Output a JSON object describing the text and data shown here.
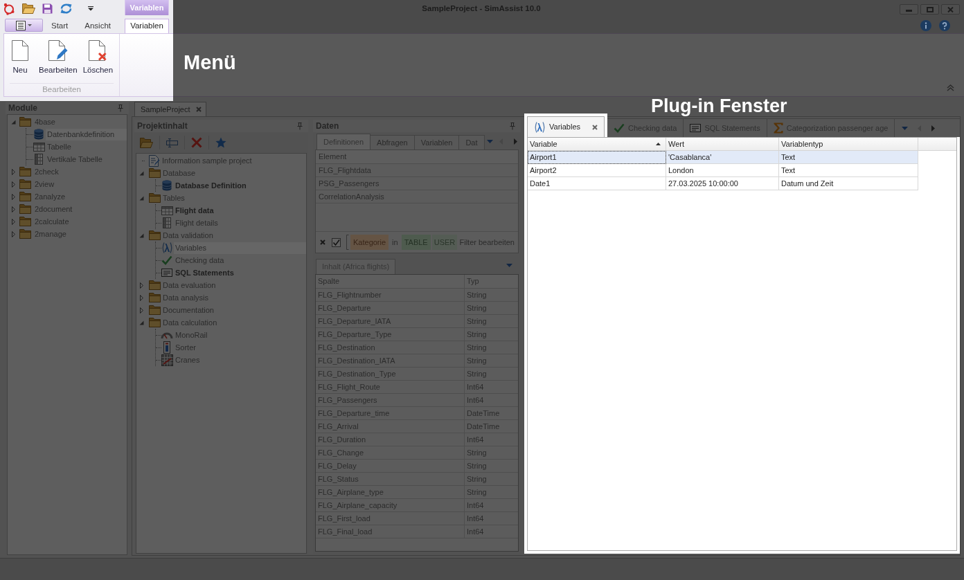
{
  "window": {
    "title": "SampleProject - SimAssist 10.0"
  },
  "ribbon": {
    "highlighted": true,
    "annotation": "Menü",
    "contextual_header": "Variablen",
    "tabs": [
      {
        "label": "Start",
        "selected": false,
        "contextual": false
      },
      {
        "label": "Ansicht",
        "selected": false,
        "contextual": false
      },
      {
        "label": "Variablen",
        "selected": true,
        "contextual": true
      }
    ],
    "groups": [
      {
        "label": "Bearbeiten",
        "buttons": [
          {
            "label": "Neu",
            "kind": "new"
          },
          {
            "label": "Bearbeiten",
            "kind": "edit"
          },
          {
            "label": "Löschen",
            "kind": "delete"
          }
        ]
      }
    ]
  },
  "module_panel": {
    "title": "Module",
    "highlighted": false,
    "tree": [
      {
        "label": "4base",
        "kind": "folder",
        "expanded": true,
        "selected": false,
        "children": [
          {
            "label": "Datenbankdefinition",
            "kind": "database",
            "selected": true
          },
          {
            "label": "Tabelle",
            "kind": "table",
            "selected": false
          },
          {
            "label": "Vertikale Tabelle",
            "kind": "vertical_table",
            "selected": false
          }
        ]
      },
      {
        "label": "2check",
        "kind": "folder",
        "expanded": false,
        "selected": false
      },
      {
        "label": "2view",
        "kind": "folder",
        "expanded": false,
        "selected": false
      },
      {
        "label": "2analyze",
        "kind": "folder",
        "expanded": false,
        "selected": false
      },
      {
        "label": "2document",
        "kind": "folder",
        "expanded": false,
        "selected": false
      },
      {
        "label": "2calculate",
        "kind": "folder",
        "expanded": false,
        "selected": false
      },
      {
        "label": "2manage",
        "kind": "folder",
        "expanded": false,
        "selected": false
      }
    ]
  },
  "document_tabs": [
    {
      "label": "SampleProject",
      "selected": true
    }
  ],
  "project_panel": {
    "title": "Projektinhalt",
    "highlighted": false,
    "tree": [
      {
        "label": "Information sample project",
        "kind": "document",
        "selected": false,
        "bold": false
      },
      {
        "label": "Database",
        "kind": "folder",
        "expanded": true,
        "selected": false,
        "bold": false,
        "children": [
          {
            "label": "Database Definition",
            "kind": "database",
            "selected": false,
            "bold": true
          }
        ]
      },
      {
        "label": "Tables",
        "kind": "folder",
        "expanded": true,
        "selected": false,
        "bold": false,
        "children": [
          {
            "label": "Flight data",
            "kind": "table",
            "selected": false,
            "bold": true
          },
          {
            "label": "Flight details",
            "kind": "vertical_table",
            "selected": false,
            "bold": false
          }
        ]
      },
      {
        "label": "Data validation",
        "kind": "folder",
        "expanded": true,
        "selected": false,
        "bold": false,
        "children": [
          {
            "label": "Variables",
            "kind": "lambda",
            "selected": true,
            "bold": false
          },
          {
            "label": "Checking data",
            "kind": "check",
            "selected": false,
            "bold": false
          },
          {
            "label": "SQL Statements",
            "kind": "sql",
            "selected": false,
            "bold": true
          }
        ]
      },
      {
        "label": "Data evaluation",
        "kind": "folder",
        "expanded": false,
        "selected": false,
        "bold": false
      },
      {
        "label": "Data analysis",
        "kind": "folder",
        "expanded": false,
        "selected": false,
        "bold": false
      },
      {
        "label": "Documentation",
        "kind": "folder",
        "expanded": false,
        "selected": false,
        "bold": false
      },
      {
        "label": "Data calculation",
        "kind": "folder",
        "expanded": true,
        "selected": false,
        "bold": false,
        "children": [
          {
            "label": "MonoRail",
            "kind": "gauge",
            "selected": false,
            "bold": false
          },
          {
            "label": "Sorter",
            "kind": "sorter",
            "selected": false,
            "bold": false
          },
          {
            "label": "Cranes",
            "kind": "crane",
            "selected": false,
            "bold": false
          }
        ]
      }
    ]
  },
  "data_panel": {
    "title": "Daten",
    "highlighted": false,
    "tabs": [
      {
        "label": "Definitionen",
        "selected": true
      },
      {
        "label": "Abfragen",
        "selected": false
      },
      {
        "label": "Variablen",
        "selected": false
      },
      {
        "label": "Dat",
        "selected": false
      }
    ],
    "definitions": {
      "columns": [
        "Element"
      ],
      "rows": [
        "FLG_Flightdata",
        "PSG_Passengers",
        "CorrelationAnalysis"
      ]
    },
    "filter": {
      "enabled": true,
      "tokens": [
        {
          "text": "Kategorie",
          "kind": "field"
        },
        {
          "text": "in",
          "kind": "operator"
        },
        {
          "text": "TABLE",
          "kind": "value"
        },
        {
          "text": "USER",
          "kind": "value_faded"
        }
      ],
      "edit_link": "Filter bearbeiten"
    },
    "content_tab": "Inhalt (Africa flights)",
    "content_table": {
      "columns": [
        "Spalte",
        "Typ"
      ],
      "rows": [
        [
          "FLG_Flightnumber",
          "String"
        ],
        [
          "FLG_Departure",
          "String"
        ],
        [
          "FLG_Departure_IATA",
          "String"
        ],
        [
          "FLG_Departure_Type",
          "String"
        ],
        [
          "FLG_Destination",
          "String"
        ],
        [
          "FLG_Destination_IATA",
          "String"
        ],
        [
          "FLG_Destination_Type",
          "String"
        ],
        [
          "FLG_Flight_Route",
          "Int64"
        ],
        [
          "FLG_Passengers",
          "Int64"
        ],
        [
          "FLG_Departure_time",
          "DateTime"
        ],
        [
          "FLG_Arrival",
          "DateTime"
        ],
        [
          "FLG_Duration",
          "Int64"
        ],
        [
          "FLG_Change",
          "String"
        ],
        [
          "FLG_Delay",
          "String"
        ],
        [
          "FLG_Status",
          "String"
        ],
        [
          "FLG_Airplane_type",
          "String"
        ],
        [
          "FLG_Airplane_capacity",
          "Int64"
        ],
        [
          "FLG_First_load",
          "Int64"
        ],
        [
          "FLG_Final_load",
          "Int64"
        ]
      ]
    }
  },
  "plugin_window": {
    "highlighted": true,
    "annotation": "Plug-in Fenster",
    "tabs": [
      {
        "label": "Variables",
        "kind": "lambda",
        "selected": true
      },
      {
        "label": "Checking data",
        "kind": "check",
        "selected": false
      },
      {
        "label": "SQL Statements",
        "kind": "sql",
        "selected": false
      },
      {
        "label": "Categorization passenger age",
        "kind": "sum",
        "selected": false
      }
    ],
    "table": {
      "columns": [
        {
          "label": "Variable",
          "sorted": true
        },
        {
          "label": "Wert",
          "sorted": false
        },
        {
          "label": "Variablentyp",
          "sorted": false
        }
      ],
      "rows": [
        {
          "cells": [
            "Airport1",
            "'Casablanca'",
            "Text"
          ],
          "selected": true
        },
        {
          "cells": [
            "Airport2",
            "London",
            "Text"
          ],
          "selected": false
        },
        {
          "cells": [
            "Date1",
            "27.03.2025 10:00:00",
            "Datum und Zeit"
          ],
          "selected": false
        }
      ]
    }
  }
}
